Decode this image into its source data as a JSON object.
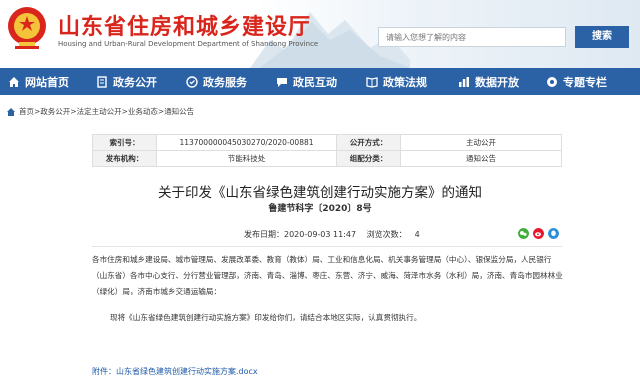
{
  "header": {
    "site_title": "山东省住房和城乡建设厅",
    "site_subtitle": "Housing and Urban-Rural Development Department of Shandong Province",
    "search_placeholder": "请输入您想了解的内容",
    "search_button": "搜索"
  },
  "nav": {
    "items": [
      {
        "label": "网站首页",
        "icon": "home-icon"
      },
      {
        "label": "政务公开",
        "icon": "document-icon"
      },
      {
        "label": "政务服务",
        "icon": "service-icon"
      },
      {
        "label": "政民互动",
        "icon": "chat-icon"
      },
      {
        "label": "政策法规",
        "icon": "book-icon"
      },
      {
        "label": "数据开放",
        "icon": "data-icon"
      },
      {
        "label": "专题专栏",
        "icon": "topic-icon"
      }
    ]
  },
  "breadcrumb": [
    "首页",
    "政务公开",
    "法定主动公开",
    "业务动态",
    "通知公告"
  ],
  "meta": {
    "index_label": "索引号：",
    "index_value": "11370000004503027​0/2020-00881",
    "public_method_label": "公开方式：",
    "public_method_value": "主动公开",
    "issuer_label": "发布机构：",
    "issuer_value": "节能科技处",
    "category_label": "组配分类：",
    "category_value": "通知公告"
  },
  "document": {
    "title": "关于印发《山东省绿色建筑创建行动实施方案》的通知",
    "doc_number": "鲁建节科字〔2020〕8号",
    "publish_time": "发布日期：2020-09-03 11:47",
    "views_label": "浏览次数：",
    "views_value": "4",
    "body_para1": "各市住房和城乡建设局、城市管理局、发展改革委、教育（教体）局、工业和信息化局、机关事务管理局（中心）、银保监分局，人民银行（山东省）各市中心支行、分行营业管理部，济南、青岛、淄博、枣庄、东营、济宁、威海、菏泽市水务（水利）局，济南、青岛市园林林业（绿化）局，济南市城乡交通运输局：",
    "body_para2": "现将《山东省绿色建筑创建行动实施方案》印发给你们，请结合本地区实际，认真贯彻执行。",
    "attachment": "附件：山东省绿色建筑创建行动实施方案.docx"
  },
  "colors": {
    "brand_red": "#d9251c",
    "nav_blue": "#2b62a6",
    "link_blue": "#1f5aa8"
  }
}
